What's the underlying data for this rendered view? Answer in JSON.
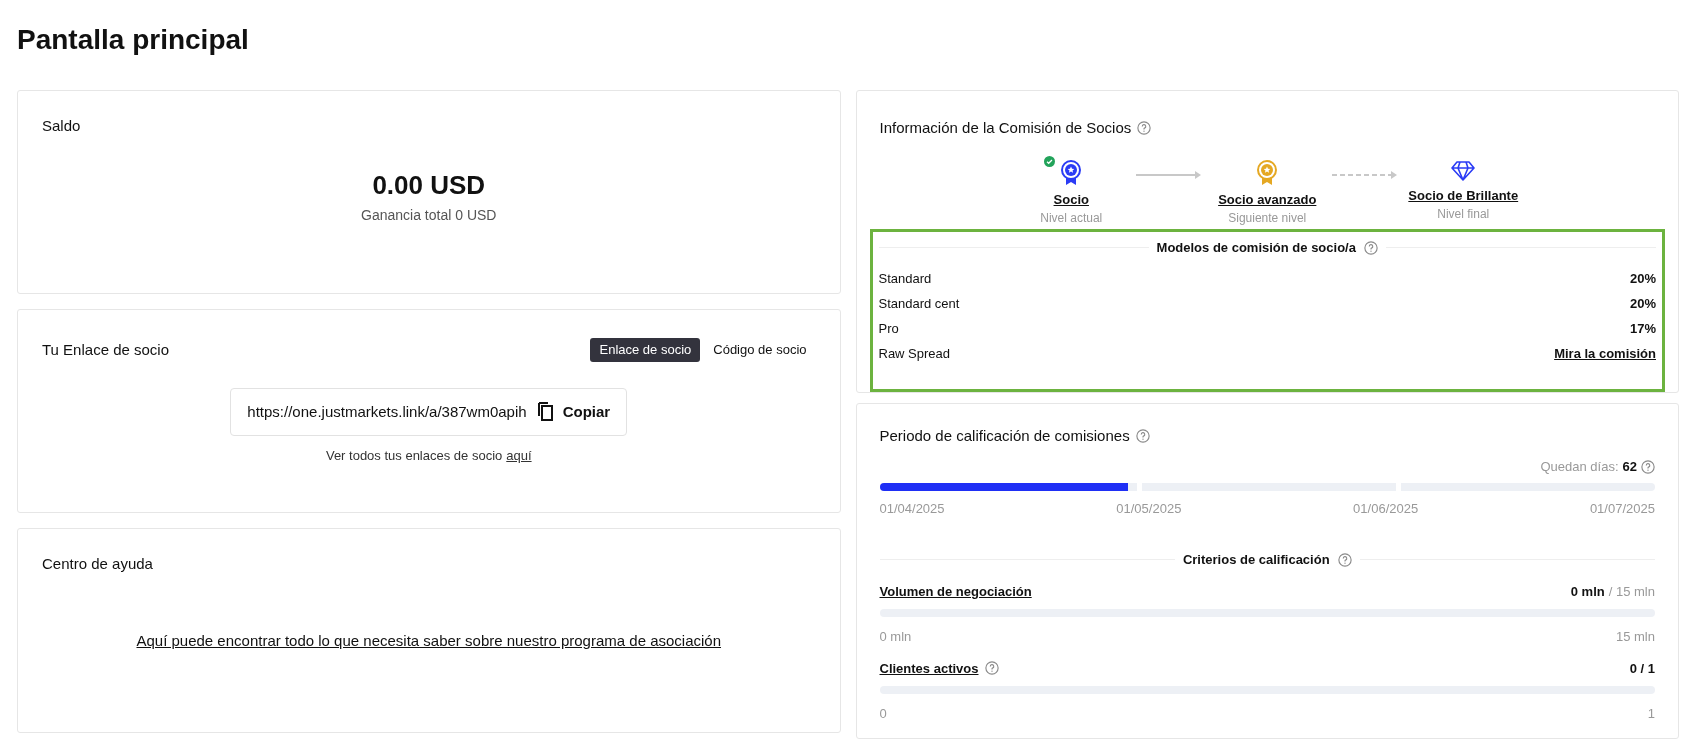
{
  "title": "Pantalla principal",
  "balance": {
    "title": "Saldo",
    "amount": "0.00 USD",
    "subtitle": "Ganancia total 0 USD"
  },
  "partner_link": {
    "title": "Tu Enlace de socio",
    "tabs": [
      {
        "label": "Enlace de socio",
        "selected": true
      },
      {
        "label": "Código de socio",
        "selected": false
      }
    ],
    "url": "https://one.justmarkets.link/a/387wm0apih",
    "copy_label": "Copiar",
    "note": "Ver todos tus enlaces de socio",
    "note_link": "aquí"
  },
  "help": {
    "title": "Centro de ayuda",
    "link": "Aquí puede encontrar todo lo que necesita saber sobre nuestro programa de asociación"
  },
  "commission": {
    "title": "Información de la Comisión de Socios",
    "levels": [
      {
        "name": "Socio",
        "caption": "Nivel actual",
        "kind": "medal",
        "color": "#2b3cf5",
        "achieved": true
      },
      {
        "name": "Socio avanzado",
        "caption": "Siguiente nivel",
        "kind": "medal",
        "color": "#e5a823",
        "achieved": false
      },
      {
        "name": "Socio de Brillante",
        "caption": "Nivel final",
        "kind": "diamond",
        "color": "#2b3cf5",
        "achieved": false
      }
    ],
    "models_title": "Modelos de comisión de socio/a",
    "models": [
      {
        "name": "Standard",
        "value": "20%",
        "kind": "text"
      },
      {
        "name": "Standard cent",
        "value": "20%",
        "kind": "text"
      },
      {
        "name": "Pro",
        "value": "17%",
        "kind": "text"
      },
      {
        "name": "Raw Spread",
        "value": "Mira la comisión",
        "kind": "link"
      }
    ]
  },
  "period": {
    "title": "Periodo de calificación de comisiones",
    "days_label": "Quedan días:",
    "days": "62",
    "level": 0.32,
    "dates": [
      "01/04/2025",
      "01/05/2025",
      "01/06/2025",
      "01/07/2025"
    ],
    "criteria_title": "Criterios de calificación",
    "criteria": [
      {
        "name": "Volumen de negociación",
        "help": false,
        "current": "0 mln",
        "target": "/ 15 mln",
        "min": "0 mln",
        "max": "15 mln"
      },
      {
        "name": "Clientes activos",
        "help": true,
        "current": "0 / 1",
        "min": "0",
        "max": "1"
      }
    ]
  }
}
